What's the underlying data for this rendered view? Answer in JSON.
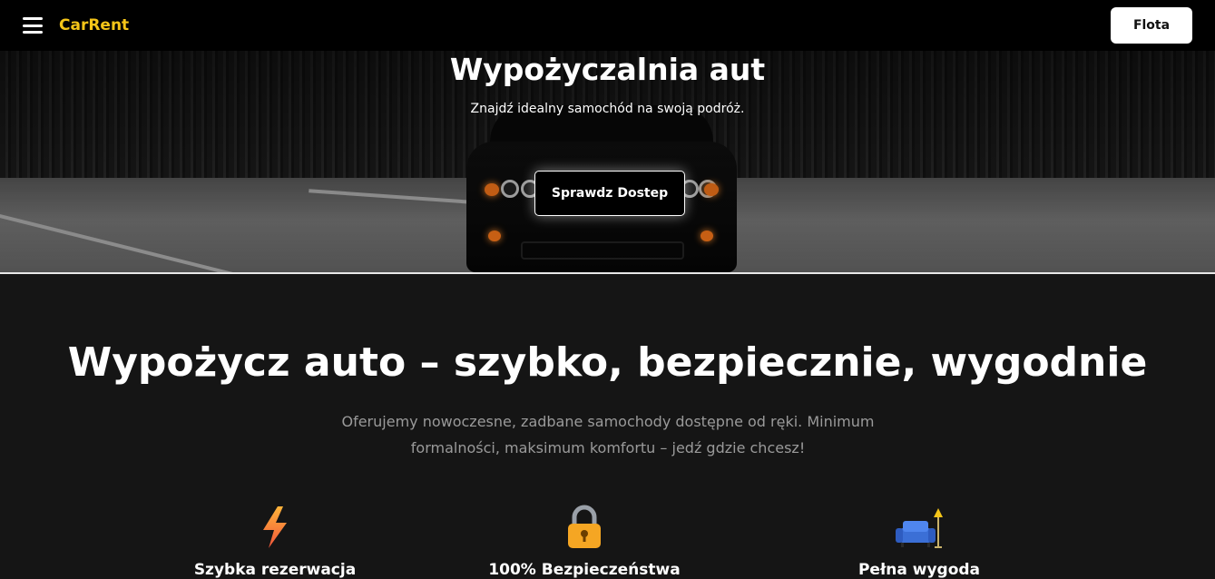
{
  "nav": {
    "menu_icon": "hamburger-menu-icon",
    "brand": "CarRent",
    "fleet_button": "Flota"
  },
  "hero": {
    "title": "Wypożyczalnia aut",
    "subtitle": "Znajdź idealny samochód na swoją podróż.",
    "cta_label": "Sprawdz Dostep"
  },
  "section": {
    "title": "Wypożycz auto – szybko, bezpiecznie, wygodnie",
    "description": "Oferujemy nowoczesne, zadbane samochody dostępne od ręki. Minimum formalności, maksimum komfortu – jedź gdzie chcesz!"
  },
  "features": [
    {
      "label": "Szybka rezerwacja",
      "icon": "lightning-icon"
    },
    {
      "label": "100% Bezpieczeństwa",
      "icon": "padlock-icon"
    },
    {
      "label": "Pełna wygoda",
      "icon": "couch-lamp-icon"
    }
  ],
  "colors": {
    "brand": "#f5c518",
    "nav_bg": "#000000",
    "section_bg": "#151515"
  }
}
